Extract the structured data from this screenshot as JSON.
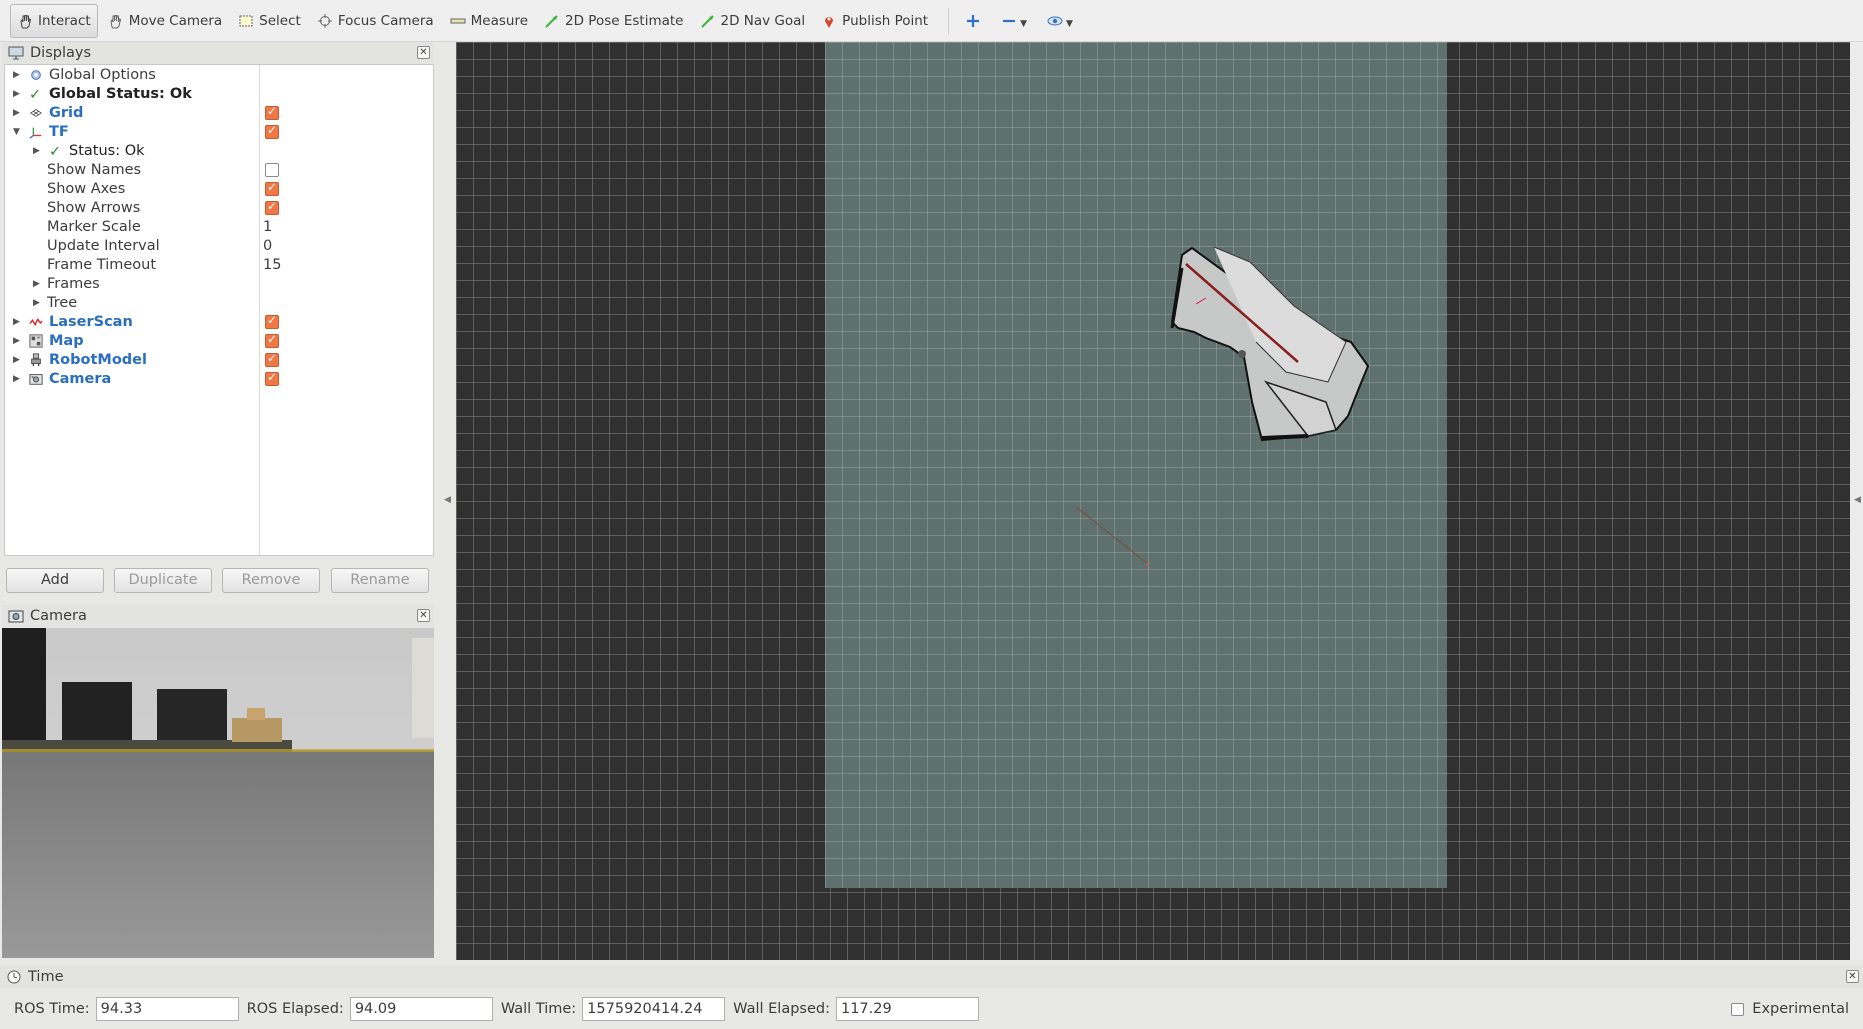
{
  "toolbar": {
    "interact": "Interact",
    "move_camera": "Move Camera",
    "select": "Select",
    "focus_camera": "Focus Camera",
    "measure": "Measure",
    "pose_estimate": "2D Pose Estimate",
    "nav_goal": "2D Nav Goal",
    "publish_point": "Publish Point"
  },
  "displays": {
    "title": "Displays",
    "items": [
      {
        "label": "Global Options"
      },
      {
        "label": "Global Status: Ok"
      },
      {
        "label": "Grid",
        "checked": true
      },
      {
        "label": "TF",
        "checked": true
      },
      {
        "label": "Status: Ok"
      },
      {
        "label": "Show Names",
        "checked": false
      },
      {
        "label": "Show Axes",
        "checked": true
      },
      {
        "label": "Show Arrows",
        "checked": true
      },
      {
        "label": "Marker Scale",
        "value": "1"
      },
      {
        "label": "Update Interval",
        "value": "0"
      },
      {
        "label": "Frame Timeout",
        "value": "15"
      },
      {
        "label": "Frames"
      },
      {
        "label": "Tree"
      },
      {
        "label": "LaserScan",
        "checked": true
      },
      {
        "label": "Map",
        "checked": true
      },
      {
        "label": "RobotModel",
        "checked": true
      },
      {
        "label": "Camera",
        "checked": true
      }
    ],
    "buttons": {
      "add": "Add",
      "duplicate": "Duplicate",
      "remove": "Remove",
      "rename": "Rename"
    }
  },
  "camera_panel": {
    "title": "Camera"
  },
  "time_panel": {
    "title": "Time",
    "ros_time_label": "ROS Time:",
    "ros_time": "94.33",
    "ros_elapsed_label": "ROS Elapsed:",
    "ros_elapsed": "94.09",
    "wall_time_label": "Wall Time:",
    "wall_time": "1575920414.24",
    "wall_elapsed_label": "Wall Elapsed:",
    "wall_elapsed": "117.29",
    "experimental": "Experimental"
  },
  "colors": {
    "checkbox_on": "#f07746",
    "blue_label": "#2a6ec0",
    "grid_bg": "#303030",
    "map_plane": "#5f716e"
  }
}
